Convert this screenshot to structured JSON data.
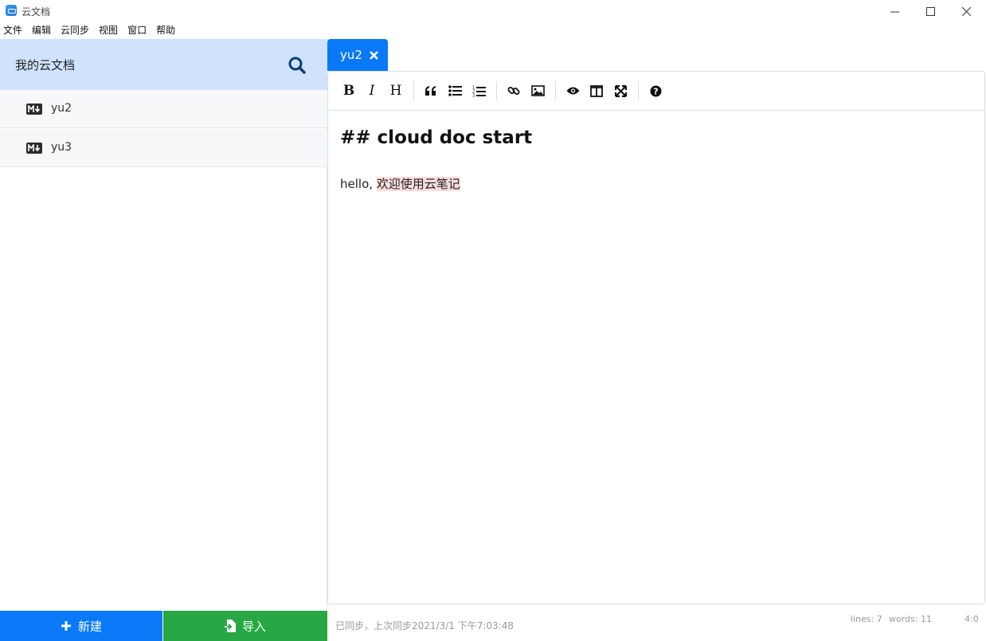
{
  "window": {
    "title": "云文档",
    "app_icon": "cloud-doc-app-icon"
  },
  "menu": [
    "文件",
    "编辑",
    "云同步",
    "视图",
    "窗口",
    "帮助"
  ],
  "sidebar": {
    "title": "我的云文档",
    "search_icon": "search-icon",
    "files": [
      {
        "name": "yu2",
        "icon": "markdown-icon"
      },
      {
        "name": "yu3",
        "icon": "markdown-icon"
      }
    ],
    "new_button": "新建",
    "import_button": "导入"
  },
  "tabs": [
    {
      "label": "yu2",
      "active": true
    }
  ],
  "toolbar": {
    "tools": [
      "bold",
      "italic",
      "heading",
      "quote",
      "unordered-list",
      "ordered-list",
      "link",
      "image",
      "preview",
      "side-by-side",
      "fullscreen",
      "guide"
    ],
    "bold": "B",
    "italic": "I",
    "heading": "H"
  },
  "document": {
    "heading": "## cloud doc start",
    "line_prefix": "hello, ",
    "line_highlight": "欢迎使用云笔记"
  },
  "status": {
    "sync": "已同步，上次同步2021/3/1 下午7:03:48",
    "lines": "lines: 7",
    "words": "words: 11",
    "cursor": "4:0"
  },
  "colors": {
    "primary": "#0a79f7",
    "success": "#28a745",
    "sidebar_header": "#cfe3fd",
    "highlight": "#fddcdc"
  }
}
